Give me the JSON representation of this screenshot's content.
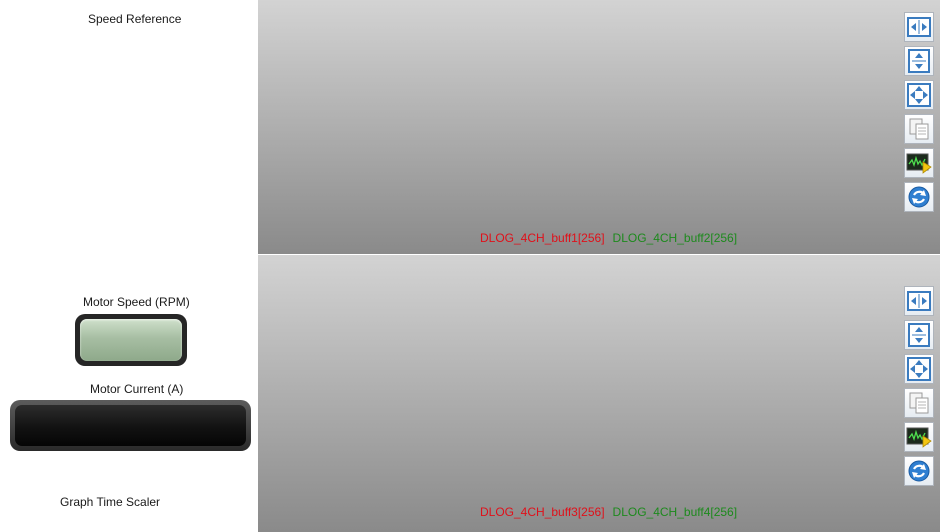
{
  "left_panel": {
    "speed_reference_label": "Speed Reference",
    "motor_speed_label": "Motor Speed (RPM)",
    "motor_current_label": "Motor Current (A)",
    "graph_time_scaler_label": "Graph Time Scaler"
  },
  "graph1": {
    "legend": [
      "DLOG_4CH_buff1[256]",
      "DLOG_4CH_buff2[256]"
    ]
  },
  "graph2": {
    "legend": [
      "DLOG_4CH_buff3[256]",
      "DLOG_4CH_buff4[256]"
    ]
  },
  "toolbar_icons": [
    "fit-horizontal-icon",
    "fit-vertical-icon",
    "fit-all-icon",
    "copy-icon",
    "export-data-icon",
    "refresh-icon"
  ],
  "colors": {
    "series_red": "#e0101a",
    "series_green": "#1d8a1d",
    "indicator_green": "#a7bea3"
  }
}
